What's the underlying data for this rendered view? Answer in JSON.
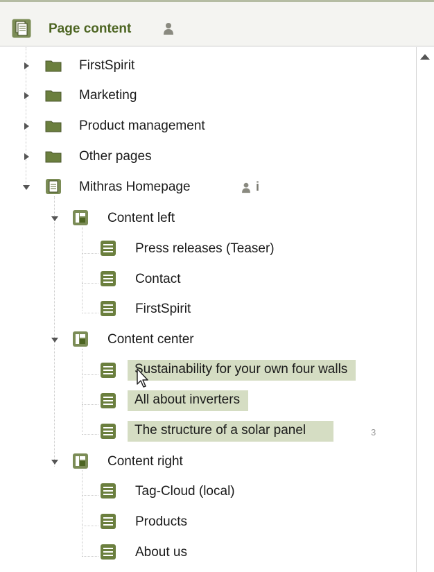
{
  "panel": {
    "title": "Page content",
    "title_icon": "page-stack-icon",
    "user_icon": "user-icon"
  },
  "tree": {
    "folders": [
      {
        "label": "FirstSpirit",
        "icon": "folder-icon",
        "expanded": false
      },
      {
        "label": "Marketing",
        "icon": "folder-icon",
        "expanded": false
      },
      {
        "label": "Product management",
        "icon": "folder-icon",
        "expanded": false
      },
      {
        "label": "Other pages",
        "icon": "folder-icon",
        "expanded": false
      }
    ],
    "page": {
      "label": "Mithras Homepage",
      "icon": "page-icon",
      "expanded": true,
      "user_icon": "user-icon",
      "info_icon": "i"
    },
    "sections": [
      {
        "label": "Content left",
        "icon": "section-icon",
        "items": [
          {
            "label": "Press releases (Teaser)",
            "icon": "paragraph-icon"
          },
          {
            "label": "Contact",
            "icon": "paragraph-icon"
          },
          {
            "label": "FirstSpirit",
            "icon": "paragraph-icon"
          }
        ]
      },
      {
        "label": "Content center",
        "icon": "section-icon",
        "items": [
          {
            "label": "Sustainability for your own four walls",
            "icon": "paragraph-icon",
            "selected": true
          },
          {
            "label": "All about inverters",
            "icon": "paragraph-icon",
            "selected": true
          },
          {
            "label": "The structure of a solar panel",
            "icon": "paragraph-icon",
            "selected": true,
            "badge": "3"
          }
        ]
      },
      {
        "label": "Content right",
        "icon": "section-icon",
        "items": [
          {
            "label": "Tag-Cloud (local)",
            "icon": "paragraph-icon"
          },
          {
            "label": "Products",
            "icon": "paragraph-icon"
          },
          {
            "label": "About us",
            "icon": "paragraph-icon"
          }
        ]
      }
    ]
  },
  "colors": {
    "accent": "#4d6522",
    "folder": "#6b7f3e",
    "selection": "#d5ddc3"
  }
}
